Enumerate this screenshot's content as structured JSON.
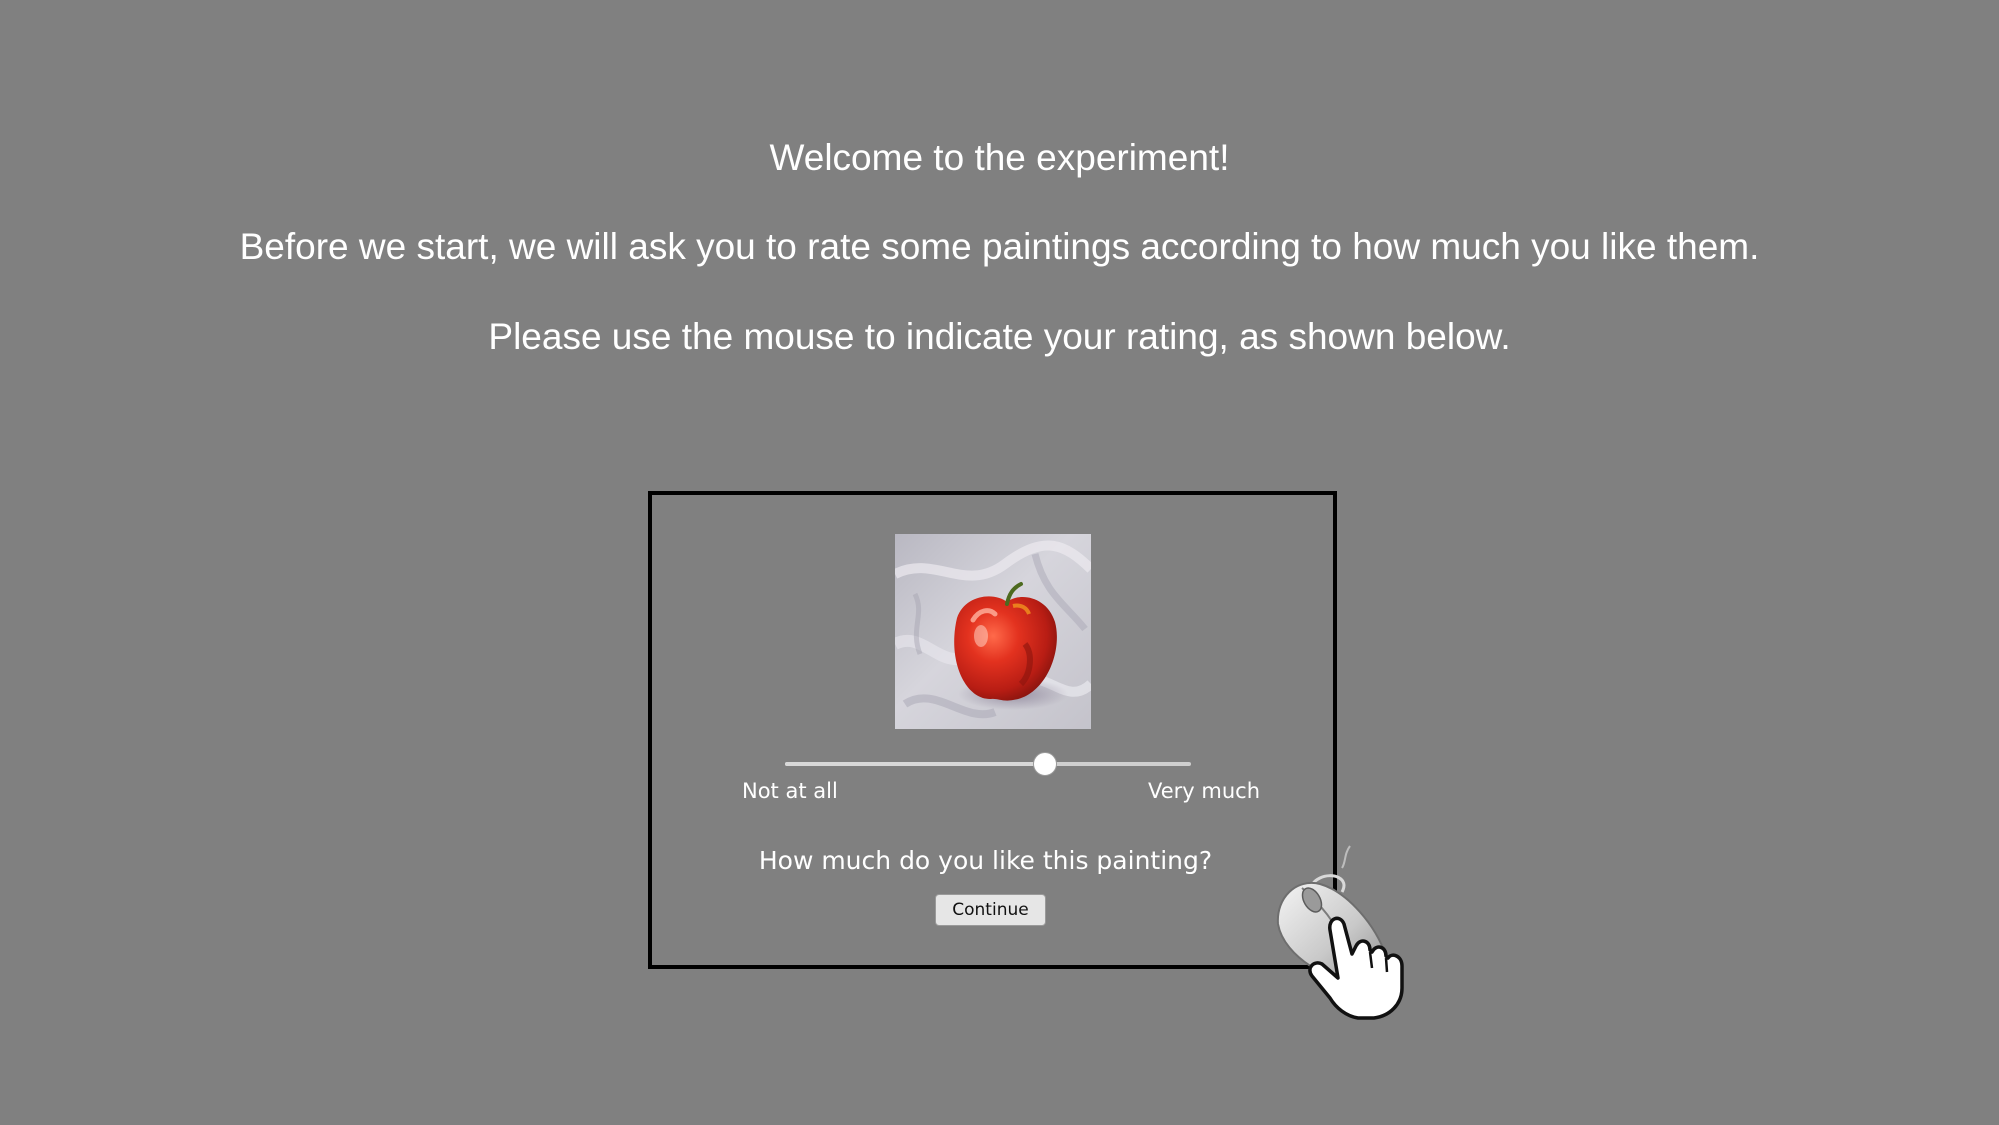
{
  "instructions": {
    "welcome": "Welcome to the experiment!",
    "rate_intro": "Before we start, we will ask you to rate some paintings according to how much you like them.",
    "mouse_hint": "Please use the mouse to indicate your rating, as shown below."
  },
  "demo": {
    "painting": {
      "icon": "apple-still-life-painting"
    },
    "slider": {
      "value_fraction": 0.64,
      "label_left": "Not at all",
      "label_right": "Very much"
    },
    "question": "How much do you like this painting?",
    "continue_label": "Continue",
    "cursor_icon": "mouse-with-pointing-hand-icon"
  },
  "colors": {
    "background": "#808080",
    "text": "#ffffff",
    "frame_border": "#000000",
    "apple_red": "#d8261a"
  }
}
